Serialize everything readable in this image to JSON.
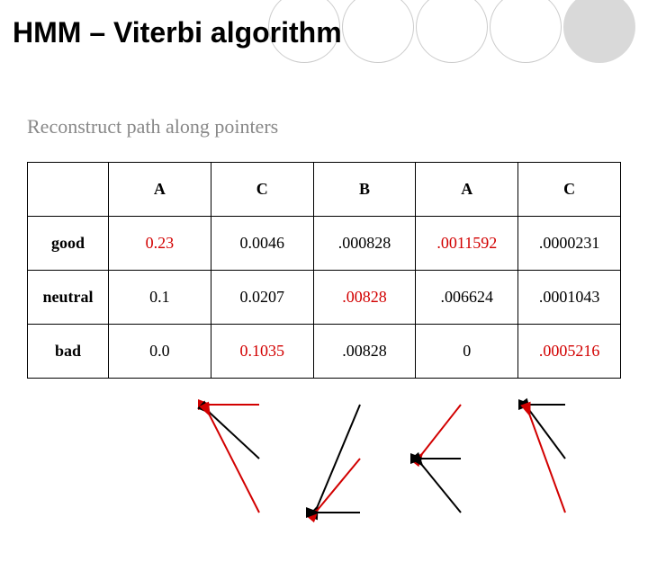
{
  "title": "HMM – Viterbi algorithm",
  "subtitle": "Reconstruct path along pointers",
  "columns": {
    "c1": "A",
    "c2": "C",
    "c3": "B",
    "c4": "A",
    "c5": "C"
  },
  "rows": {
    "r1": "good",
    "r2": "neutral",
    "r3": "bad"
  },
  "cells": {
    "good": {
      "A1": "0.23",
      "C": "0.0046",
      "B": ".000828",
      "A2": ".0011592",
      "C2": ".0000231"
    },
    "neutral": {
      "A1": "0.1",
      "C": "0.0207",
      "B": ".00828",
      "A2": ".006624",
      "C2": ".0001043"
    },
    "bad": {
      "A1": "0.0",
      "C": "0.1035",
      "B": ".00828",
      "A2": "0",
      "C2": ".0005216"
    }
  },
  "chart_data": {
    "type": "table",
    "title": "Viterbi trellis values",
    "columns": [
      "A",
      "C",
      "B",
      "A",
      "C"
    ],
    "rows": [
      "good",
      "neutral",
      "bad"
    ],
    "values": [
      [
        0.23,
        0.0046,
        0.000828,
        0.0011592,
        2.31e-05
      ],
      [
        0.1,
        0.0207,
        0.00828,
        0.006624,
        0.0001043
      ],
      [
        0.0,
        0.1035,
        0.00828,
        0,
        0.0005216
      ]
    ],
    "best_path_rows": [
      "good",
      "bad",
      "neutral",
      "good",
      "bad"
    ],
    "back_pointers": [
      {
        "from_col": 1,
        "from_row": "good",
        "to_col": 0,
        "to_row": "good",
        "on_path": true
      },
      {
        "from_col": 1,
        "from_row": "neutral",
        "to_col": 0,
        "to_row": "good",
        "on_path": false
      },
      {
        "from_col": 1,
        "from_row": "bad",
        "to_col": 0,
        "to_row": "good",
        "on_path": true
      },
      {
        "from_col": 2,
        "from_row": "good",
        "to_col": 1,
        "to_row": "bad",
        "on_path": false
      },
      {
        "from_col": 2,
        "from_row": "neutral",
        "to_col": 1,
        "to_row": "bad",
        "on_path": true
      },
      {
        "from_col": 2,
        "from_row": "bad",
        "to_col": 1,
        "to_row": "bad",
        "on_path": false
      },
      {
        "from_col": 3,
        "from_row": "good",
        "to_col": 2,
        "to_row": "neutral",
        "on_path": true
      },
      {
        "from_col": 3,
        "from_row": "neutral",
        "to_col": 2,
        "to_row": "neutral",
        "on_path": false
      },
      {
        "from_col": 3,
        "from_row": "bad",
        "to_col": 2,
        "to_row": "neutral",
        "on_path": false
      },
      {
        "from_col": 4,
        "from_row": "good",
        "to_col": 3,
        "to_row": "good",
        "on_path": false
      },
      {
        "from_col": 4,
        "from_row": "neutral",
        "to_col": 3,
        "to_row": "good",
        "on_path": false
      },
      {
        "from_col": 4,
        "from_row": "bad",
        "to_col": 3,
        "to_row": "good",
        "on_path": true
      }
    ]
  }
}
